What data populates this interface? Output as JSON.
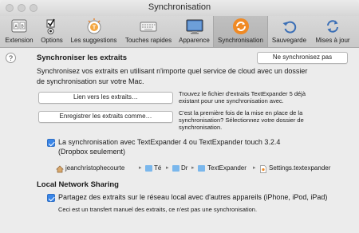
{
  "window": {
    "title": "Synchronisation"
  },
  "toolbar": {
    "items": [
      {
        "label": "Extension",
        "icon": "extension-icon"
      },
      {
        "label": "Options",
        "icon": "options-icon"
      },
      {
        "label": "Les suggestions",
        "icon": "suggestions-icon"
      },
      {
        "label": "Touches rapides",
        "icon": "keyboard-icon"
      },
      {
        "label": "Apparence",
        "icon": "appearance-icon"
      },
      {
        "label": "Synchronisation",
        "icon": "sync-icon",
        "selected": true
      },
      {
        "label": "Sauvegarde",
        "icon": "backup-icon"
      },
      {
        "label": "Mises à jour",
        "icon": "updates-icon"
      }
    ]
  },
  "sync": {
    "help": "?",
    "heading": "Synchroniser les extraits",
    "nosync_button": "Ne synchronisez pas",
    "desc_line1": "Synchronisez vos extraits en utilisant n'importe quel service de cloud avec un dossier",
    "desc_line2": "de synchronisation sur votre Mac.",
    "link_button": "Lien vers les extraits…",
    "link_note_line1": "Trouvez le fichier d'extraits TextExpander 5 déjà",
    "link_note_line2": "existant pour une synchronisation avec.",
    "save_button": "Enregistrer les extraits comme…",
    "save_note_line1": "C'est la première fois de la mise en place de la",
    "save_note_line2": "synchronisation? Sélectionnez votre dossier de",
    "save_note_line3": "synchronisation.",
    "te4_line1": "La synchronisation avec TextExpander 4 ou TextExpander touch 3.2.4",
    "te4_line2": "(Dropbox seulement)",
    "path": [
      "jeanchristophecourte",
      "Té",
      "Dr",
      "TextExpander",
      "Settings.textexpander"
    ]
  },
  "local": {
    "heading": "Local Network Sharing",
    "share_label": "Partagez des extraits sur le réseau local avec d'autres appareils (iPhone, iPod, iPad)",
    "share_note": "Ceci est un transfert manuel des extraits, ce n'est pas une synchronisation."
  }
}
